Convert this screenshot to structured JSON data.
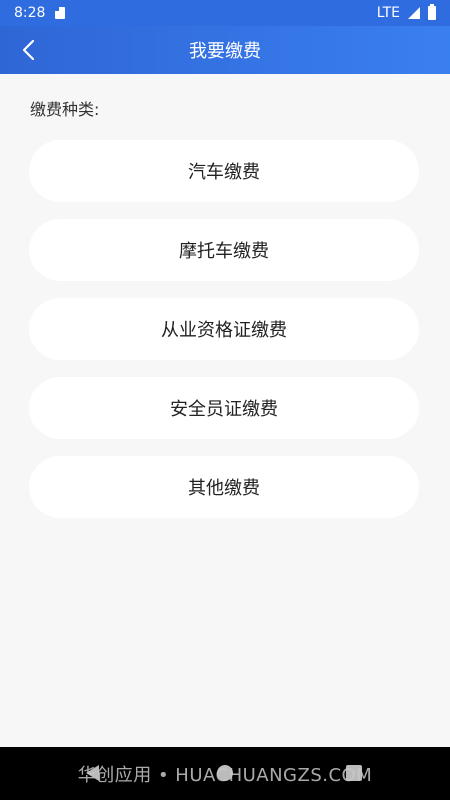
{
  "status_bar": {
    "time": "8:28",
    "network": "LTE"
  },
  "app_bar": {
    "title": "我要缴费"
  },
  "section": {
    "label": "缴费种类:"
  },
  "options": [
    {
      "label": "汽车缴费"
    },
    {
      "label": "摩托车缴费"
    },
    {
      "label": "从业资格证缴费"
    },
    {
      "label": "安全员证缴费"
    },
    {
      "label": "其他缴费"
    }
  ],
  "watermark": {
    "text": "华创应用 • HUACHUANGZS.COM"
  },
  "colors": {
    "primary": "#2f6ce0",
    "background": "#f7f7f7",
    "card": "#ffffff"
  }
}
